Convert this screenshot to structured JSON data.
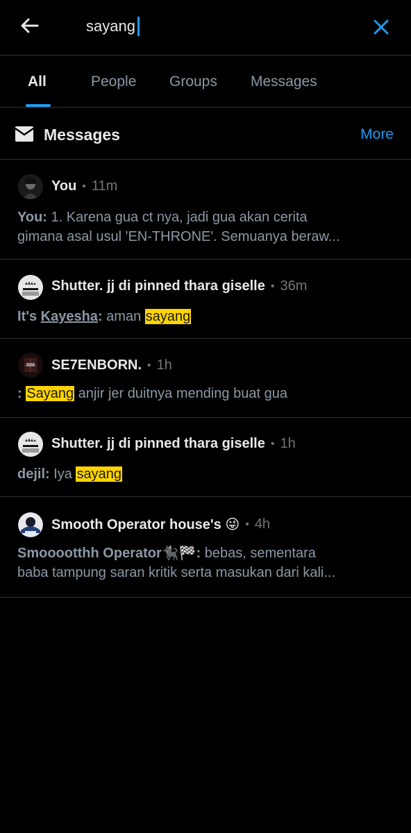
{
  "search": {
    "query": "sayang"
  },
  "tabs": [
    {
      "label": "All"
    },
    {
      "label": "People"
    },
    {
      "label": "Groups"
    },
    {
      "label": "Messages"
    }
  ],
  "section": {
    "title": "Messages",
    "more_label": "More"
  },
  "results": [
    {
      "name": "You",
      "time": "11m",
      "sender": "You:",
      "line1": " 1. Karena gua ct nya, jadi gua akan cerita",
      "line2": "gimana asal usul 'EN-THRONE'. Semuanya beraw..."
    },
    {
      "name": "Shutter. jj di pinned thara giselle",
      "time": "36m",
      "sender_pre": "It's ",
      "sender_u": "Kayesha",
      "sender_post": ":",
      "text_before": " aman ",
      "highlight": "sayang",
      "text_after": ""
    },
    {
      "name": "SE7ENBORN.",
      "time": "1h",
      "sender": ":",
      "text_before": " ",
      "highlight": "Sayang",
      "text_after": " anjir jer duitnya mending buat gua"
    },
    {
      "name": "Shutter. jj di pinned thara giselle",
      "time": "1h",
      "sender": "dejil:",
      "text_before": " Iya ",
      "highlight": "sayang",
      "text_after": ""
    },
    {
      "name": "Smooth Operator house's 😜",
      "time": "4h",
      "sender": "Smooootthh Operator🐈‍⬛🏁:",
      "line1": " bebas, sementara",
      "line2": "baba tampung saran kritik serta masukan dari kali..."
    }
  ],
  "colors": {
    "accent": "#1d9bf0",
    "highlight": "#ffd400",
    "divider": "#2f3336"
  },
  "icons": {
    "back": "arrow-left-icon",
    "close": "close-icon",
    "section": "envelope-icon"
  }
}
